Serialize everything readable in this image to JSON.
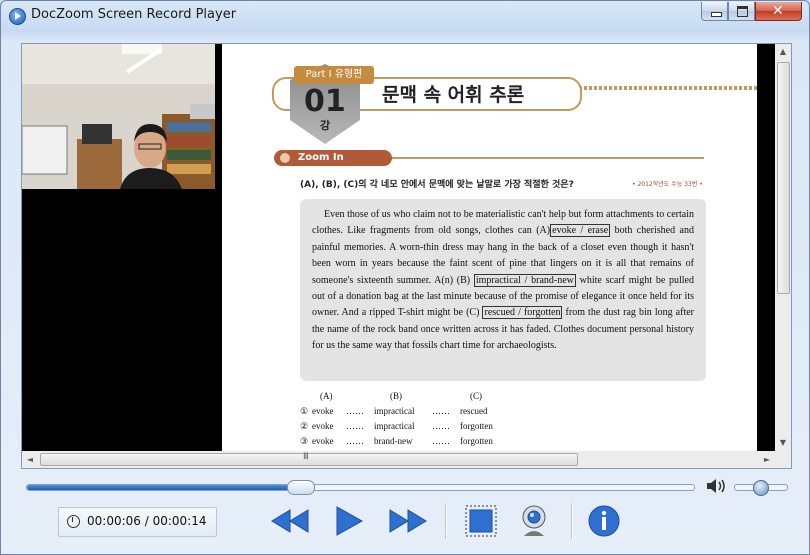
{
  "window": {
    "title": "DocZoom Screen Record Player",
    "close_glyph": "✕"
  },
  "document": {
    "part_tag": "Part Ⅰ 유형편",
    "lesson_number": "01",
    "lesson_unit": "강",
    "lesson_title": "문맥 속 어휘 추론",
    "zoom_label": "Zoom In",
    "question": "(A), (B), (C)의 각 네모 안에서 문맥에 맞는 낱말로 가장 적절한 것은?",
    "source": "• 2012학년도 수능 33번 •",
    "passage": {
      "p1": "Even those of us who claim not to be materialistic can't help but form attachments to certain clothes. Like fragments from old songs, clothes can (A)",
      "a_box": "evoke / erase",
      "p2": " both cherished and painful memories. A worn-thin dress may hang in the back of a closet even though it hasn't been worn in years because the faint scent of pine that lingers on it is all that remains of someone's sixteenth summer. A(n) (B) ",
      "b_box": "impractical / brand-new",
      "p3": " white scarf might be pulled out of a donation bag at the last minute because of the promise of elegance it once held for its owner. And a ripped T-shirt might be (C) ",
      "c_box": "rescued / forgotten",
      "p4": " from the dust rag bin long after the name of the rock band once written across it has faded. Clothes document personal history for us the same way that fossils chart time for archaeologists."
    },
    "choices": {
      "headers": [
        "(A)",
        "(B)",
        "(C)"
      ],
      "dots": "……",
      "rows": [
        {
          "num": "①",
          "a": "evoke",
          "b": "impractical",
          "c": "rescued"
        },
        {
          "num": "②",
          "a": "evoke",
          "b": "impractical",
          "c": "forgotten"
        },
        {
          "num": "③",
          "a": "evoke",
          "b": "brand-new",
          "c": "forgotten"
        }
      ]
    }
  },
  "scrollbars": {
    "up": "▲",
    "down": "▼",
    "left": "◄",
    "right": "►",
    "grip": "III"
  },
  "player": {
    "current_time": "00:00:06",
    "separator": " / ",
    "total_time": "00:00:14",
    "progress": 0.41,
    "volume": 0.5,
    "colors": {
      "accent": "#1d5db4",
      "button_blue": "#2f6fd0"
    }
  }
}
